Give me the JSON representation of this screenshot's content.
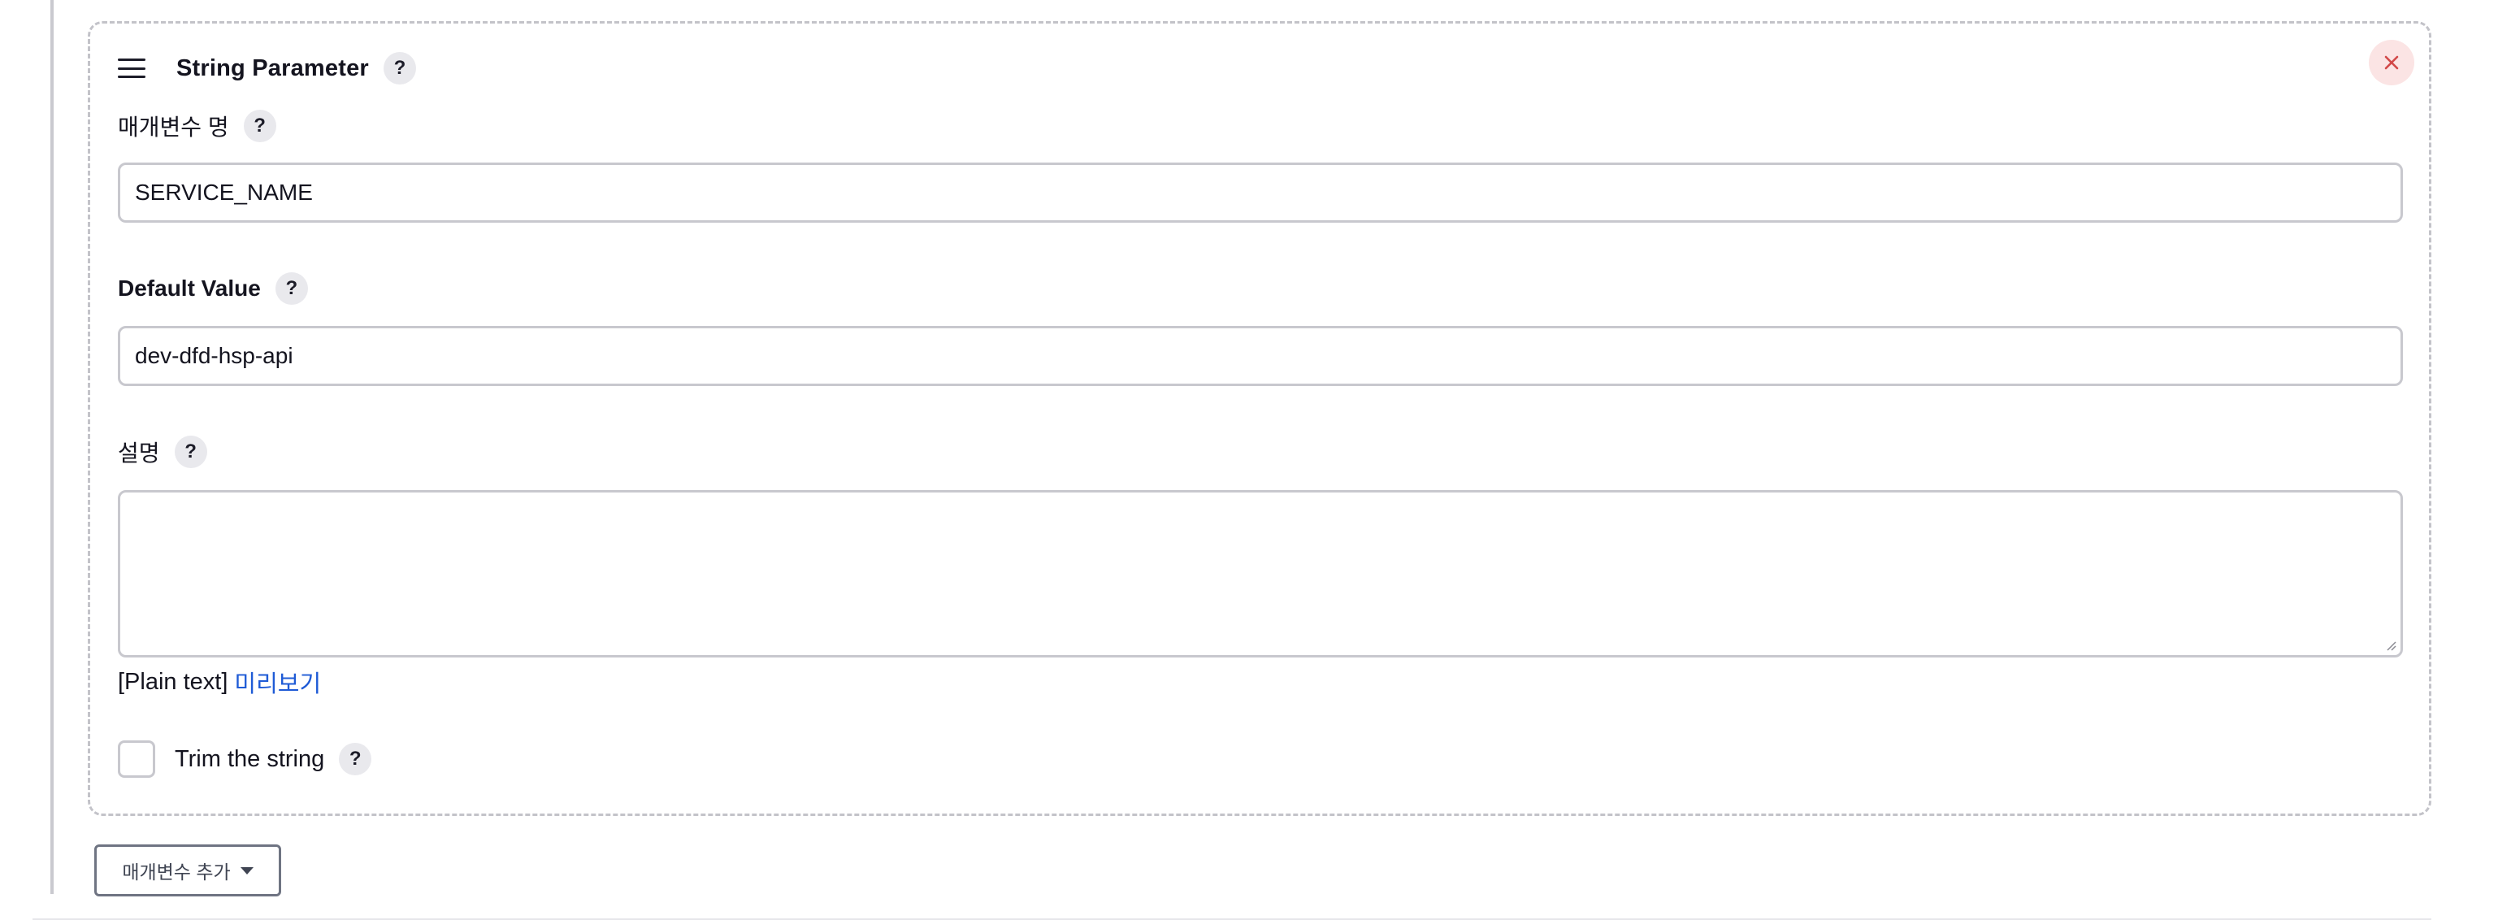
{
  "block": {
    "title": "String Parameter",
    "help_glyph": "?"
  },
  "fields": {
    "name": {
      "label": "매개변수 명",
      "value": "SERVICE_NAME"
    },
    "default_value": {
      "label": "Default Value",
      "value": "dev-dfd-hsp-api"
    },
    "description": {
      "label": "설명",
      "value": ""
    }
  },
  "markup": {
    "format_text": "[Plain text]",
    "preview_link": "미리보기"
  },
  "trim": {
    "label": "Trim the string",
    "checked": false
  },
  "add_button": {
    "label": "매개변수 추가"
  },
  "colors": {
    "close_icon": "#d24848",
    "close_bg": "#fbe4e4",
    "link": "#1f5bd6"
  }
}
